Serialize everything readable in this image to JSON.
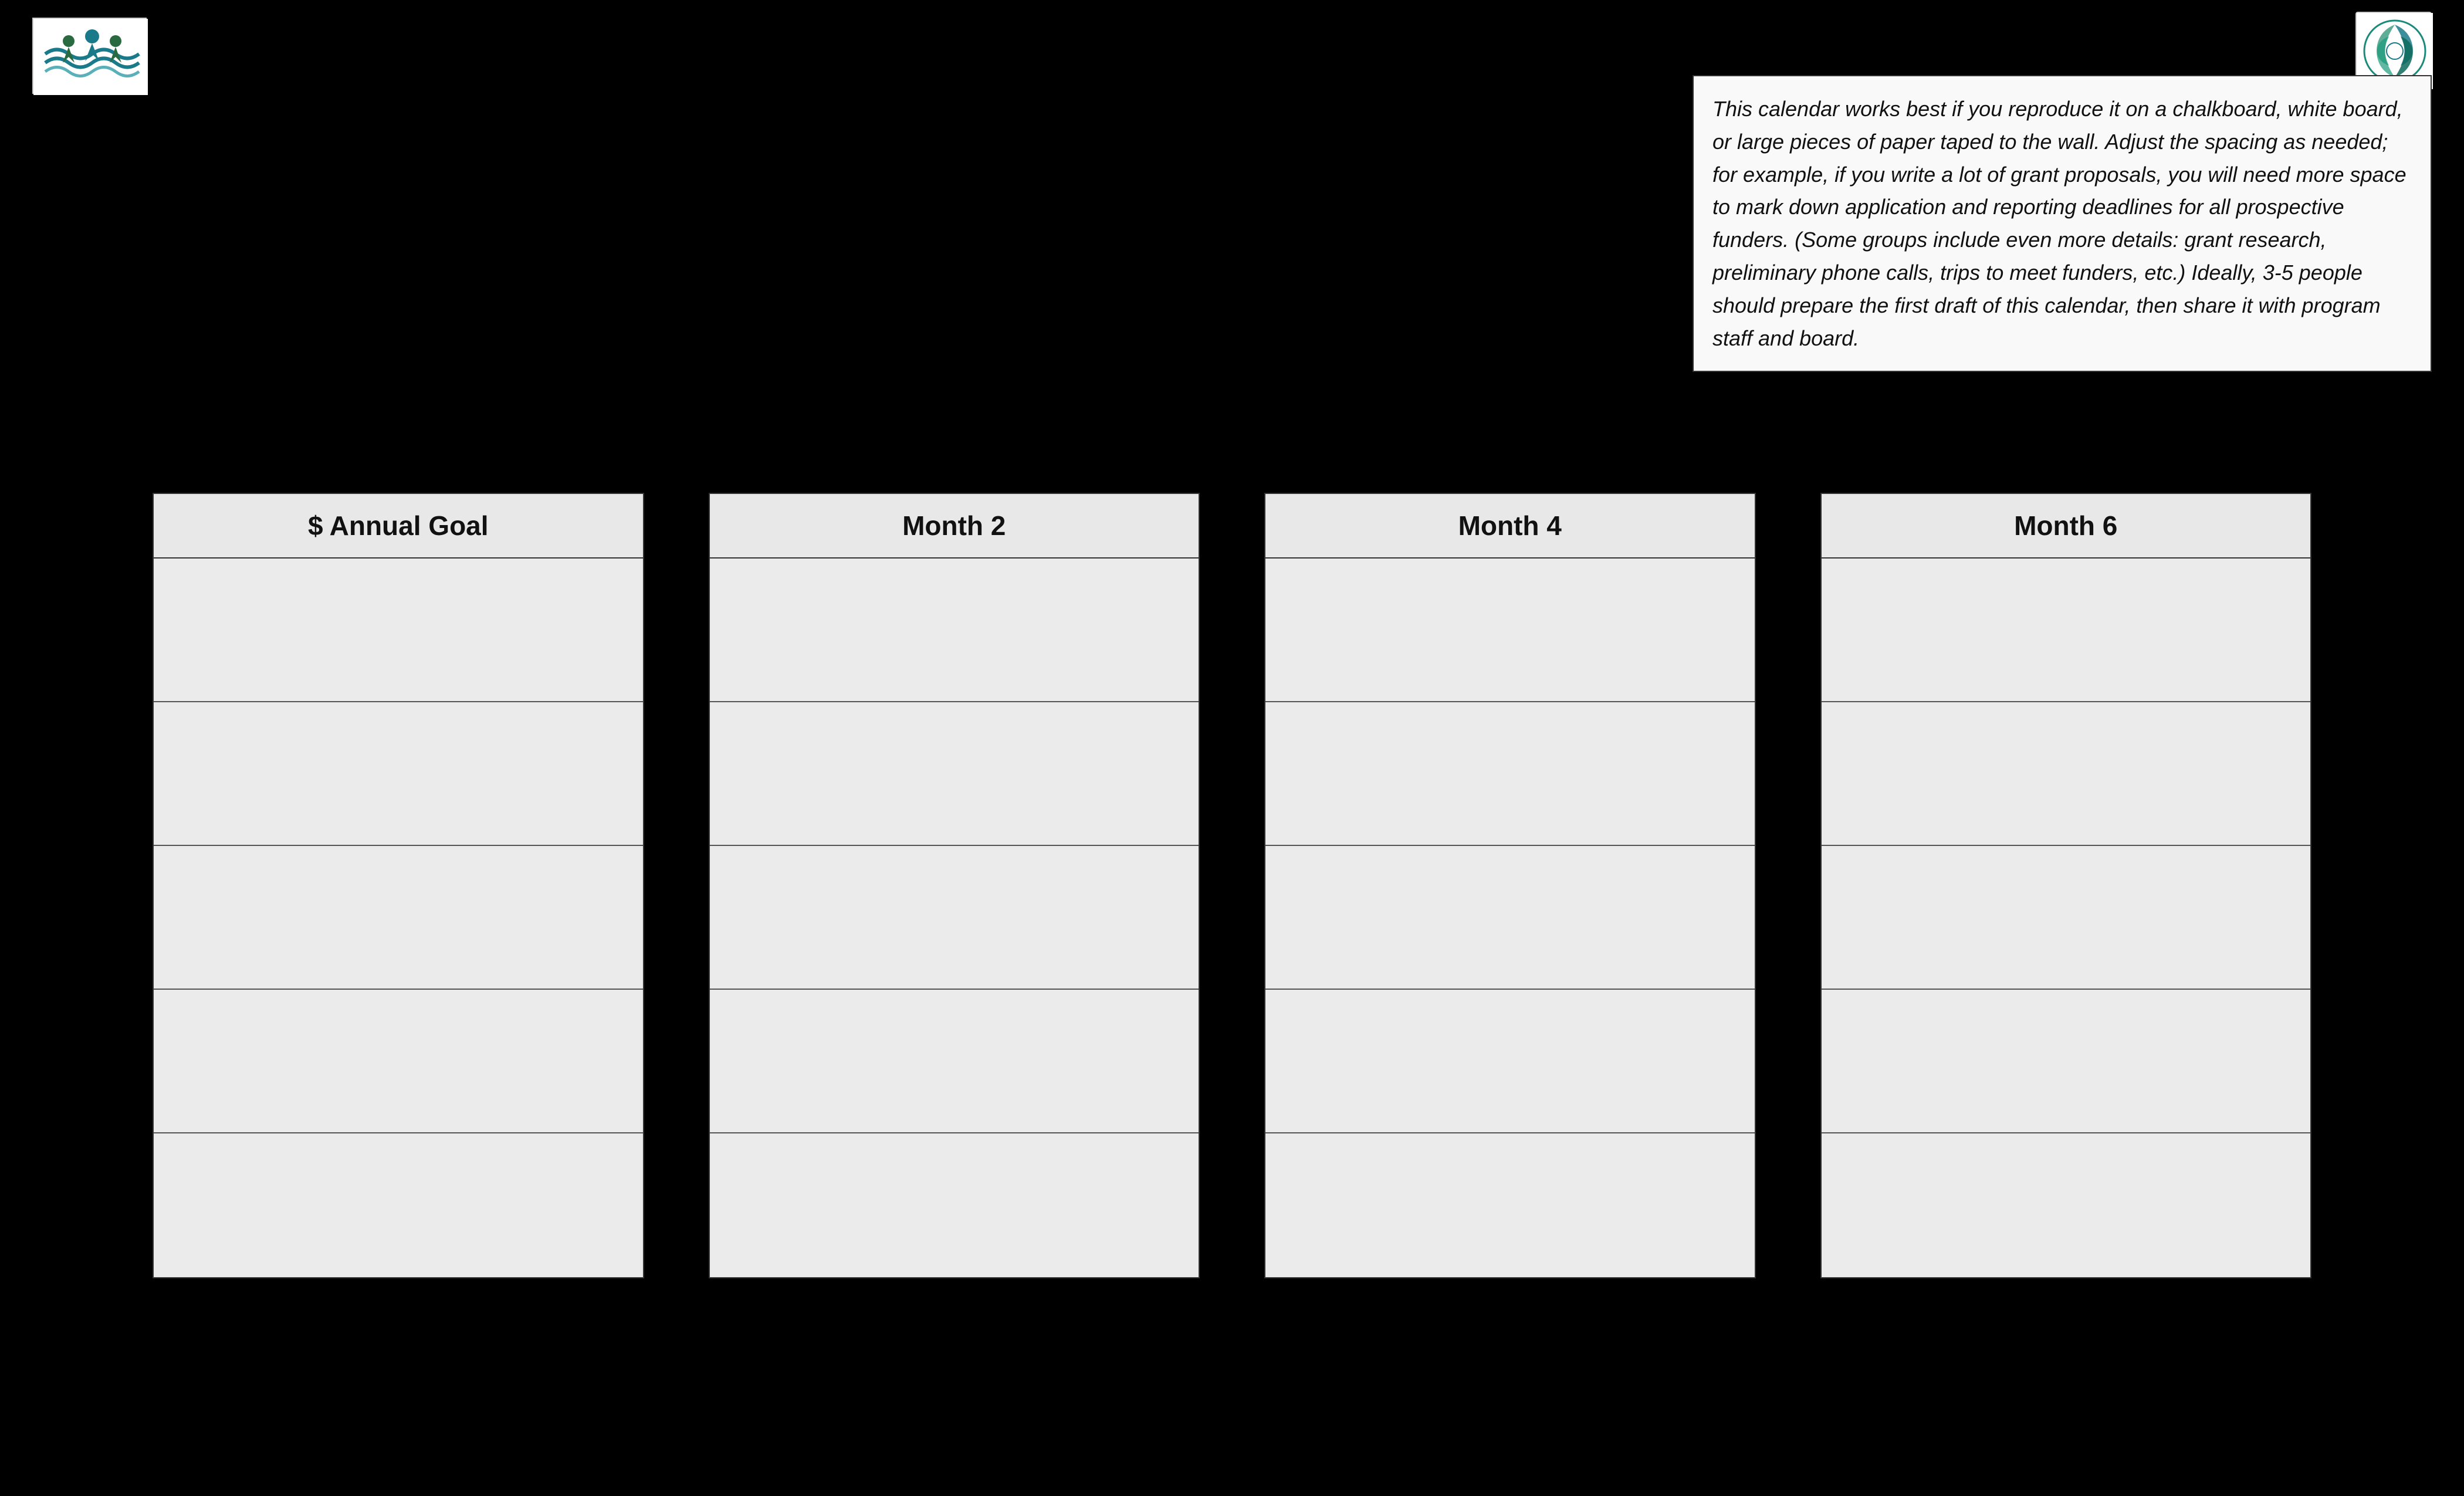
{
  "logos": {
    "left_alt": "Organization waves logo",
    "right_alt": "Organization circular logo"
  },
  "info_box": {
    "text": "This calendar works best if you reproduce it on a chalkboard, white board, or large pieces of paper taped to the wall.   Adjust the spacing as needed; for example, if you write a lot of grant proposals, you will need more space to mark down application and reporting deadlines for all prospective funders. (Some groups include even more details: grant research, preliminary phone calls, trips to meet funders, etc.)  Ideally, 3-5 people should prepare the first draft of this calendar, then share it with program staff and board."
  },
  "columns": [
    {
      "id": "col1",
      "header": "$ Annual Goal",
      "rows": 5
    },
    {
      "id": "col2",
      "header": "Month 2",
      "rows": 5
    },
    {
      "id": "col3",
      "header": "Month 4",
      "rows": 5
    },
    {
      "id": "col4",
      "header": "Month 6",
      "rows": 5
    }
  ],
  "colors": {
    "background": "#000000",
    "cell_bg": "#ebebeb",
    "header_bg": "#e8e8e8",
    "border": "#333333",
    "text": "#111111"
  }
}
